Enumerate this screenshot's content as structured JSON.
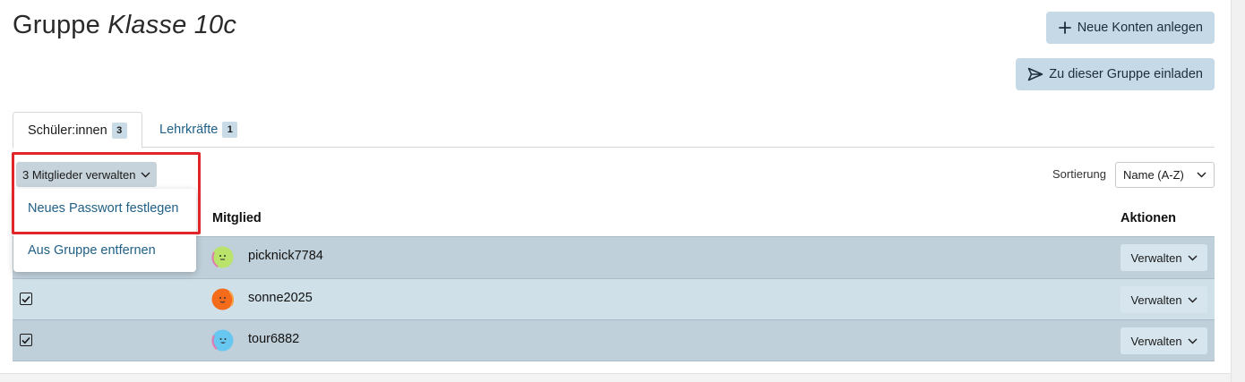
{
  "page": {
    "title_prefix": "Gruppe",
    "title_group": "Klasse 10c"
  },
  "actions": {
    "new_accounts": "Neue Konten anlegen",
    "invite": "Zu dieser Gruppe einladen"
  },
  "tabs": [
    {
      "label": "Schüler:innen",
      "count": "3",
      "active": true
    },
    {
      "label": "Lehrkräfte",
      "count": "1",
      "active": false
    }
  ],
  "bulk": {
    "label": "3 Mitglieder verwalten",
    "menu": [
      {
        "label": "Neues Passwort festlegen"
      },
      {
        "label": "Aus Gruppe entfernen"
      }
    ]
  },
  "sort": {
    "label": "Sortierung",
    "value": "Name (A-Z)"
  },
  "table": {
    "headers": {
      "member": "Mitglied",
      "actions": "Aktionen"
    },
    "rows": [
      {
        "name": "picknick7784",
        "action": "Verwalten",
        "checked": true,
        "avatar_color": "#b9e36a",
        "avatar_face": "-_-"
      },
      {
        "name": "sonne2025",
        "action": "Verwalten",
        "checked": true,
        "avatar_color": "#f46b1b",
        "avatar_face": "-_-"
      },
      {
        "name": "tour6882",
        "action": "Verwalten",
        "checked": true,
        "avatar_color": "#67c7f0",
        "avatar_face": "^o^"
      }
    ]
  },
  "colors": {
    "accent_link": "#1f5f86",
    "button_bg": "#c5d9e6",
    "highlight": "#e0252b"
  }
}
